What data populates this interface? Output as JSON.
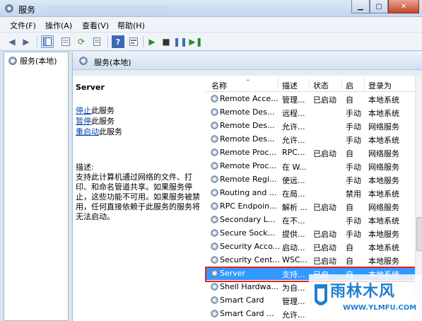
{
  "window": {
    "title": "服务"
  },
  "menu": [
    "文件(F)",
    "操作(A)",
    "查看(V)",
    "帮助(H)"
  ],
  "tree": {
    "root_label": "服务(本地)"
  },
  "panel": {
    "header_title": "服务(本地)"
  },
  "details": {
    "service_name": "Server",
    "actions": [
      {
        "link": "停止",
        "rest": "此服务"
      },
      {
        "link": "暂停",
        "rest": "此服务"
      },
      {
        "link": "重启动",
        "rest": "此服务"
      }
    ],
    "description_label": "描述:",
    "description_text": "支持此计算机通过网络的文件、打印、和命名管道共享。如果服务停止，这些功能不可用。如果服务被禁用，任何直接依赖于此服务的服务将无法启动。"
  },
  "table": {
    "columns": [
      "名称",
      "描述",
      "状态",
      "启",
      "登录为"
    ],
    "rows": [
      [
        "Remote Acce...",
        "管理...",
        "已启动",
        "自",
        "本地系统"
      ],
      [
        "Remote Des...",
        "远程...",
        "",
        "手动",
        "本地系统"
      ],
      [
        "Remote Des...",
        "允许...",
        "",
        "手动",
        "网络服务"
      ],
      [
        "Remote Des...",
        "允许...",
        "",
        "手动",
        "本地系统"
      ],
      [
        "Remote Proc...",
        "RPC...",
        "已启动",
        "自",
        "网络服务"
      ],
      [
        "Remote Proc...",
        "在 W...",
        "",
        "手动",
        "网络服务"
      ],
      [
        "Remote Regi...",
        "使远...",
        "",
        "手动",
        "本地服务"
      ],
      [
        "Routing and ...",
        "在局...",
        "",
        "禁用",
        "本地系统"
      ],
      [
        "RPC Endpoin...",
        "解析 ...",
        "已启动",
        "自",
        "网络服务"
      ],
      [
        "Secondary L...",
        "在不...",
        "",
        "手动",
        "本地系统"
      ],
      [
        "Secure Sock...",
        "提供...",
        "已启动",
        "手动",
        "本地服务"
      ],
      [
        "Security Acco...",
        "启动...",
        "已启动",
        "自",
        "本地系统"
      ],
      [
        "Security Cent...",
        "WSC...",
        "已启动",
        "自",
        "本地服务"
      ],
      [
        "Server",
        "支持...",
        "已启",
        "自",
        "本地系统"
      ],
      [
        "Shell Hardwa...",
        "为自...",
        "",
        "",
        ""
      ],
      [
        "Smart Card",
        "管理...",
        "",
        "",
        ""
      ],
      [
        "Smart Card ...",
        "允许...",
        "",
        "",
        ""
      ]
    ],
    "selected_index": 13
  },
  "watermark": {
    "text": "雨林木风",
    "url": "WWW.YLMFU.COM"
  },
  "colors": {
    "selection": "#3399ff",
    "highlight_border": "#e3231b",
    "link": "#0645ad"
  }
}
